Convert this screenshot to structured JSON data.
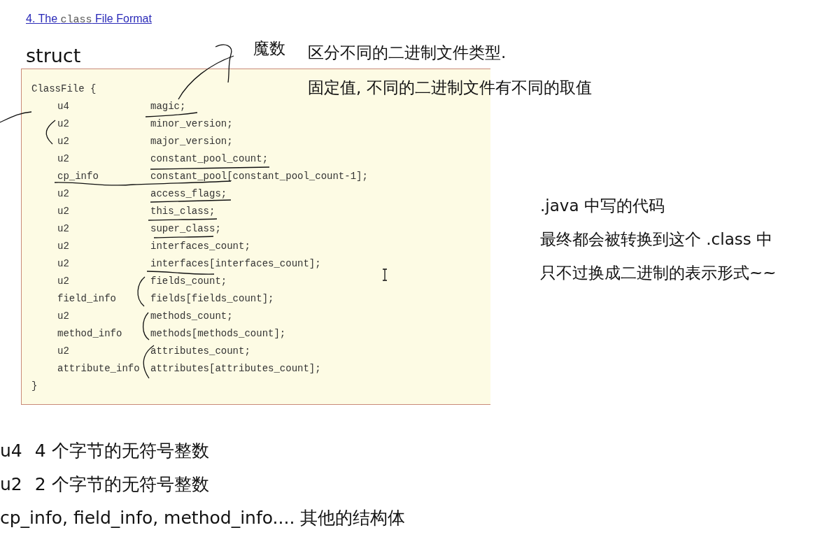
{
  "link": {
    "before": "4. The ",
    "code": "class",
    "after": " File Format"
  },
  "heading": "struct",
  "code_block": {
    "header": "ClassFile {",
    "footer": "}",
    "rows": [
      {
        "type": "u4",
        "name": "magic;"
      },
      {
        "type": "u2",
        "name": "minor_version;"
      },
      {
        "type": "u2",
        "name": "major_version;"
      },
      {
        "type": "u2",
        "name": "constant_pool_count;"
      },
      {
        "type": "cp_info",
        "name": "constant_pool[constant_pool_count-1];"
      },
      {
        "type": "u2",
        "name": "access_flags;"
      },
      {
        "type": "u2",
        "name": "this_class;"
      },
      {
        "type": "u2",
        "name": "super_class;"
      },
      {
        "type": "u2",
        "name": "interfaces_count;"
      },
      {
        "type": "u2",
        "name": "interfaces[interfaces_count];"
      },
      {
        "type": "u2",
        "name": "fields_count;"
      },
      {
        "type": "field_info",
        "name": "fields[fields_count];"
      },
      {
        "type": "u2",
        "name": "methods_count;"
      },
      {
        "type": "method_info",
        "name": "methods[methods_count];"
      },
      {
        "type": "u2",
        "name": "attributes_count;"
      },
      {
        "type": "attribute_info",
        "name": "attributes[attributes_count];"
      }
    ]
  },
  "magic_label": "魔数",
  "magic_notes": [
    "区分不同的二进制文件类型.",
    "固定值, 不同的二进制文件有不同的取值"
  ],
  "side_notes": [
    ".java 中写的代码",
    "最终都会被转换到这个 .class 中",
    "只不过换成二进制的表示形式~~"
  ],
  "legend": [
    {
      "term": "u4",
      "text": "4 个字节的无符号整数"
    },
    {
      "term": "u2",
      "text": "2 个字节的无符号整数"
    },
    {
      "text": "cp_info, field_info, method_info.... 其他的结构体"
    }
  ]
}
